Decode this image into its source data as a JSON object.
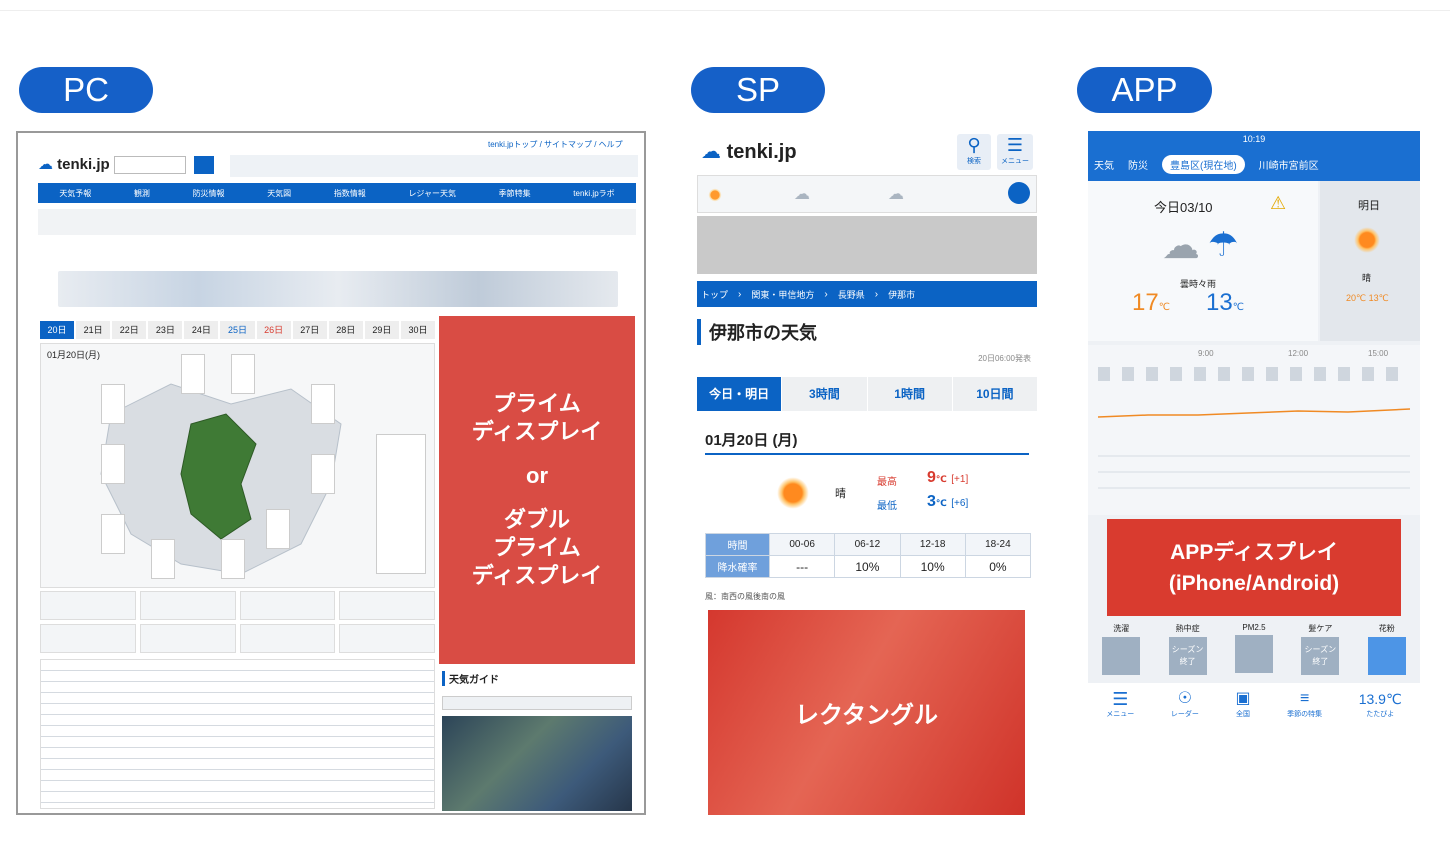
{
  "labels": {
    "pc": "PC",
    "sp": "SP",
    "app": "APP"
  },
  "pc": {
    "logo": "tenki.jp",
    "header_links": "tenki.jpトップ / サイトマップ / ヘルプ",
    "nav": [
      "天気予報",
      "観測",
      "防災情報",
      "天気図",
      "指数情報",
      "レジャー天気",
      "季節特集",
      "tenki.jpラボ"
    ],
    "date_tabs": [
      "20日",
      "21日",
      "22日",
      "23日",
      "24日",
      "25日",
      "26日",
      "27日",
      "28日",
      "29日",
      "30日"
    ],
    "map_date": "01月20日(月)",
    "guide_title": "天気ガイド",
    "overlay_line1": "プライム",
    "overlay_line2": "ディスプレイ",
    "overlay_or": "or",
    "overlay_line3": "ダブル",
    "overlay_line4": "プライム",
    "overlay_line5": "ディスプレイ"
  },
  "sp": {
    "logo": "tenki.jp",
    "search_label": "検索",
    "menu_label": "メニュー",
    "breadcrumb": [
      "トップ",
      "関東・甲信地方",
      "長野県",
      "伊那市"
    ],
    "page_title": "伊那市の天気",
    "announced": "20日06:00発表",
    "tabs": [
      "今日・明日",
      "3時間",
      "1時間",
      "10日間"
    ],
    "date": "01月20日 (月)",
    "weather": "晴",
    "high_label": "最高",
    "high_value": "9",
    "high_diff": "[+1]",
    "low_label": "最低",
    "low_value": "3",
    "low_diff": "[+6]",
    "temp_unit": "℃",
    "table_head": [
      "時間",
      "00-06",
      "06-12",
      "12-18",
      "18-24"
    ],
    "table_row_label": "降水確率",
    "table_row": [
      "---",
      "10%",
      "10%",
      "0%"
    ],
    "wind": "風：南西の風後南の風",
    "overlay": "レクタングル"
  },
  "app": {
    "status_time": "10:19",
    "tabs": [
      "天気",
      "防災",
      "豊島区(現在地)",
      "川崎市宮前区"
    ],
    "today_date": "今日03/10",
    "tomorrow": "明日",
    "today_weather": "曇時々雨",
    "today_high": "17",
    "today_low": "13",
    "tomorrow_weather": "晴",
    "tomorrow_temps": "20℃ 13℃",
    "times": [
      "9:00",
      "12:00",
      "15:00"
    ],
    "overlay_line1": "APPディスプレイ",
    "overlay_line2": "(iPhone/Android)",
    "index_labels": [
      "洗濯",
      "熱中症",
      "PM2.5",
      "髪ケア",
      "花粉"
    ],
    "index_badge": "シーズン終了",
    "bottom_nav": [
      "メニュー",
      "レーダー",
      "全国",
      "季節の特集",
      "たたびよ"
    ],
    "bottom_temp": "13.9℃"
  },
  "colors": {
    "accent": "#1560c8",
    "overlay": "#d22d23",
    "tenki_blue": "#0b63c4"
  }
}
